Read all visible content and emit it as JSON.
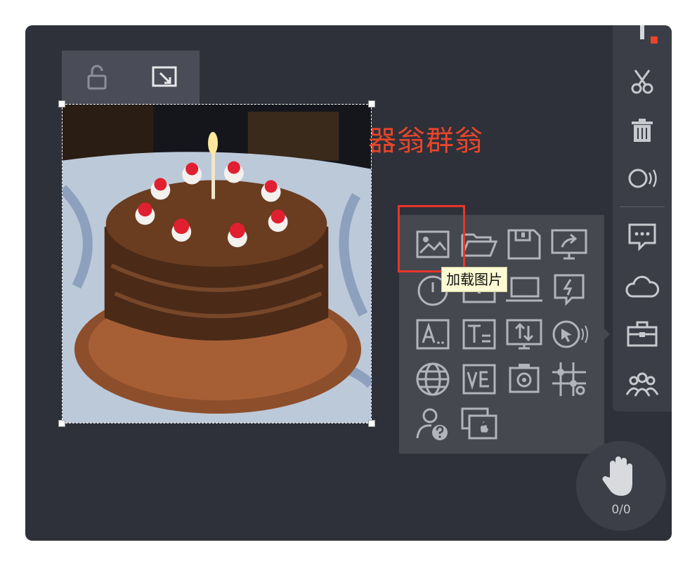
{
  "canvas": {
    "text": "器翁群翁",
    "text_color": "#e8452c",
    "image_description_icon": "birthday-cake-photo"
  },
  "object_toolbar": {
    "lock_icon": "unlock-icon",
    "resize_icon": "fit-resize-icon"
  },
  "right_toolbar": {
    "record_indicator_color": "#f0432c",
    "items": [
      {
        "icon": "pen-icon"
      },
      {
        "icon": "scissors-icon"
      },
      {
        "icon": "trash-icon"
      },
      {
        "icon": "broadcast-icon"
      },
      {
        "icon": "chat-bubble-icon"
      },
      {
        "icon": "cloud-icon"
      },
      {
        "icon": "toolbox-icon"
      },
      {
        "icon": "group-users-icon"
      }
    ]
  },
  "tools_panel": {
    "tooltip": "加载图片",
    "items": [
      {
        "icon": "load-image-icon"
      },
      {
        "icon": "open-folder-icon"
      },
      {
        "icon": "save-disk-icon"
      },
      {
        "icon": "share-screen-icon"
      },
      {
        "icon": "timer-icon"
      },
      {
        "icon": "slide-board-icon"
      },
      {
        "icon": "laptop-icon"
      },
      {
        "icon": "flash-icon"
      },
      {
        "icon": "text-box-icon"
      },
      {
        "icon": "text-field-icon"
      },
      {
        "icon": "screen-sync-icon"
      },
      {
        "icon": "pointer-icon"
      },
      {
        "icon": "globe-icon"
      },
      {
        "icon": "vote-icon"
      },
      {
        "icon": "camera-capture-icon"
      },
      {
        "icon": "grid-sliders-icon"
      },
      {
        "icon": "user-help-icon"
      },
      {
        "icon": "mac-screen-icon"
      }
    ]
  },
  "hand_raise": {
    "icon": "raise-hand-icon",
    "count": "0/0"
  }
}
